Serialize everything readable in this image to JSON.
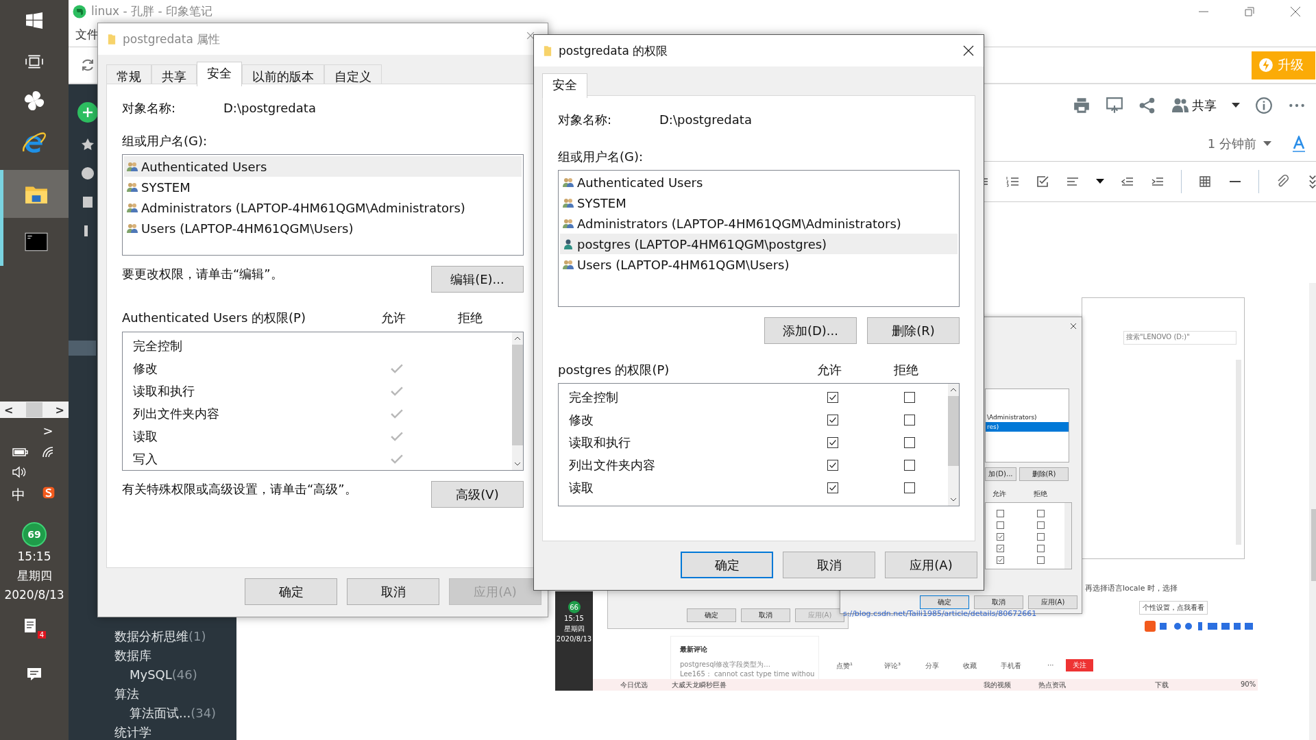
{
  "taskbar": {
    "scroll_left": "<",
    "scroll_right": ">",
    "expand": ">",
    "ime": "中",
    "badge": "69",
    "time": "15:15",
    "weekday": "星期四",
    "date": "2020/8/13",
    "notification_count": "4"
  },
  "app_window": {
    "title": "linux - 孔胖 - 印象笔记",
    "menu": [
      "文件"
    ],
    "upgrade": "升级",
    "share": "共享",
    "modified": "1 分钟前",
    "notebooks": [
      {
        "label": "数据分析思维",
        "count": "(1)"
      },
      {
        "label": "数据库",
        "children": [
          {
            "label": "MySQL",
            "count": "(46)"
          }
        ]
      },
      {
        "label": "算法",
        "children": [
          {
            "label": "算法面试...",
            "count": "(34)"
          }
        ]
      },
      {
        "label": "统计学"
      }
    ]
  },
  "properties_dialog": {
    "title": "postgredata 属性",
    "tabs": [
      {
        "label": "常规",
        "selected": false
      },
      {
        "label": "共享",
        "selected": false
      },
      {
        "label": "安全",
        "selected": true
      },
      {
        "label": "以前的版本",
        "selected": false
      },
      {
        "label": "自定义",
        "selected": false
      }
    ],
    "object_label": "对象名称:",
    "object_value": "D:\\postgredata",
    "group_label": "组或用户名(G):",
    "principals": [
      {
        "name": "Authenticated Users",
        "kind": "group",
        "selected": true
      },
      {
        "name": "SYSTEM",
        "kind": "group",
        "selected": false
      },
      {
        "name": "Administrators (LAPTOP-4HM61QGM\\Administrators)",
        "kind": "group",
        "selected": false
      },
      {
        "name": "Users (LAPTOP-4HM61QGM\\Users)",
        "kind": "group",
        "selected": false
      }
    ],
    "edit_hint": "要更改权限，请单击“编辑”。",
    "edit_button": "编辑(E)...",
    "perm_title": "Authenticated Users 的权限(P)",
    "allow_label": "允许",
    "deny_label": "拒绝",
    "permissions": [
      {
        "name": "完全控制",
        "allow": false,
        "deny": false
      },
      {
        "name": "修改",
        "allow": true,
        "deny": false
      },
      {
        "name": "读取和执行",
        "allow": true,
        "deny": false
      },
      {
        "name": "列出文件夹内容",
        "allow": true,
        "deny": false
      },
      {
        "name": "读取",
        "allow": true,
        "deny": false
      },
      {
        "name": "写入",
        "allow": true,
        "deny": false
      }
    ],
    "advanced_hint": "有关特殊权限或高级设置，请单击“高级”。",
    "advanced_button": "高级(V)",
    "buttons": [
      {
        "label": "确定",
        "disabled": false
      },
      {
        "label": "取消",
        "disabled": false
      },
      {
        "label": "应用(A)",
        "disabled": true
      }
    ]
  },
  "permissions_dialog": {
    "title": "postgredata 的权限",
    "tabs": [
      {
        "label": "安全",
        "selected": true
      }
    ],
    "object_label": "对象名称:",
    "object_value": "D:\\postgredata",
    "group_label": "组或用户名(G):",
    "principals": [
      {
        "name": "Authenticated Users",
        "kind": "group",
        "selected": false
      },
      {
        "name": "SYSTEM",
        "kind": "group",
        "selected": false
      },
      {
        "name": "Administrators (LAPTOP-4HM61QGM\\Administrators)",
        "kind": "group",
        "selected": false
      },
      {
        "name": "postgres (LAPTOP-4HM61QGM\\postgres)",
        "kind": "user",
        "selected": true
      },
      {
        "name": "Users (LAPTOP-4HM61QGM\\Users)",
        "kind": "group",
        "selected": false
      }
    ],
    "add_button": "添加(D)...",
    "remove_button": "删除(R)",
    "perm_title": "postgres 的权限(P)",
    "allow_label": "允许",
    "deny_label": "拒绝",
    "permissions": [
      {
        "name": "完全控制",
        "allow": true,
        "deny": false
      },
      {
        "name": "修改",
        "allow": true,
        "deny": false
      },
      {
        "name": "读取和执行",
        "allow": true,
        "deny": false
      },
      {
        "name": "列出文件夹内容",
        "allow": true,
        "deny": false
      },
      {
        "name": "读取",
        "allow": true,
        "deny": false
      }
    ],
    "buttons": [
      {
        "label": "确定",
        "default": true
      },
      {
        "label": "取消",
        "default": false
      },
      {
        "label": "应用(A)",
        "default": false
      }
    ]
  },
  "note_screenshot": {
    "search_placeholder": "搜索\"LENOVO (D:)\"",
    "list_items": [
      {
        "name": "\\Administrators)",
        "selected": false
      },
      {
        "name": "res)",
        "selected": true
      }
    ],
    "add_button": "加(D)...",
    "remove_button": "删除(R)",
    "allow_label": "允许",
    "deny_label": "拒绝",
    "permissions": [
      {
        "allow": false,
        "deny": false
      },
      {
        "allow": false,
        "deny": false
      },
      {
        "allow": true,
        "deny": false
      },
      {
        "allow": true,
        "deny": false
      },
      {
        "allow": true,
        "deny": false
      }
    ],
    "buttons": [
      {
        "label": "确定",
        "default": true
      },
      {
        "label": "取消",
        "default": false
      },
      {
        "label": "应用(A)",
        "default": false
      }
    ],
    "back_buttons": [
      {
        "label": "确定",
        "disabled": false
      },
      {
        "label": "取消",
        "disabled": false
      },
      {
        "label": "应用(A)",
        "disabled": true
      }
    ],
    "article_text": "再选择语言locale 时，选择",
    "url": "s://blog.csdn.net/Taili1985/article/details/80672661",
    "tooltip": "个性设置，点我看看",
    "taskbar": {
      "badge": "66",
      "time": "15:15",
      "weekday": "星期四",
      "date": "2020/8/13"
    },
    "comments_title": "最新评论",
    "comments": [
      "postgresql修改字段类型为...",
      "Lee165： cannot cast type time withou"
    ],
    "actions": [
      "点赞¹",
      "评论³",
      "分享",
      "收藏",
      "手机看",
      "···"
    ],
    "follow": "关注",
    "status_items": [
      "今日优选",
      "大威天龙瞬秒巨兽",
      "我的视频",
      "热点资讯",
      "下载",
      "90%"
    ]
  }
}
